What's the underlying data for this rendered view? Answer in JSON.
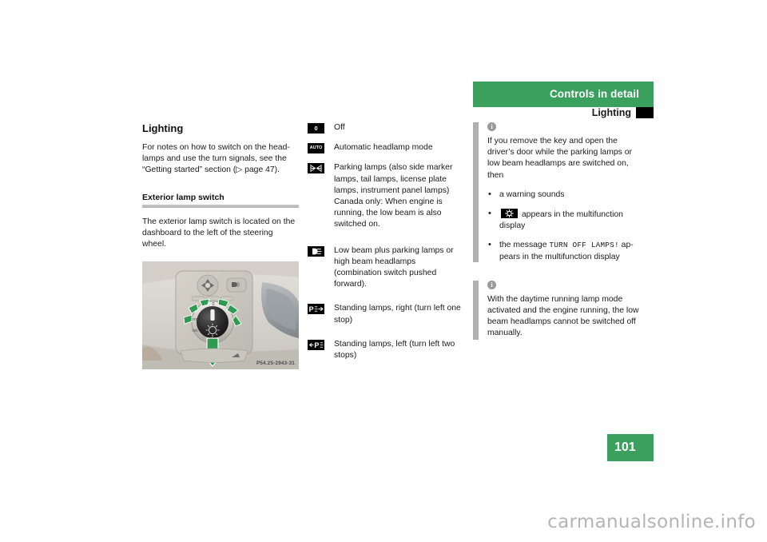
{
  "header": {
    "banner_title": "Controls in detail",
    "sub_title": "Lighting",
    "banner_color": "#3aa05e"
  },
  "left_column": {
    "heading": "Lighting",
    "intro": "For notes on how to switch on the head-lamps and use the turn signals, see the “Getting started” section (▷ page 47).",
    "subheading": "Exterior lamp switch",
    "body": "The exterior lamp switch is located on the dashboard to the left of the steering wheel.",
    "figure_caption": "P54.25-2943-31"
  },
  "switch_positions": [
    {
      "icon": "off-position-icon",
      "icon_label": "0",
      "text": "Off"
    },
    {
      "icon": "auto-headlamp-icon",
      "icon_label": "AUTO",
      "text": "Automatic headlamp mode"
    },
    {
      "icon": "parking-lamps-icon",
      "icon_label": "",
      "text": "Parking lamps (also side marker lamps, tail lamps, license plate lamps, instrument panel lamps) Canada only: When engine is running, the low beam is also switched on."
    },
    {
      "icon": "low-beam-headlamp-icon",
      "icon_label": "",
      "text": "Low beam plus parking lamps or high beam headlamps (combination switch pushed forward)."
    },
    {
      "icon": "standing-lamps-right-icon",
      "icon_label": "P",
      "text": "Standing lamps, right (turn left one stop)"
    },
    {
      "icon": "standing-lamps-left-icon",
      "icon_label": "P",
      "text": "Standing lamps, left (turn left two stops)"
    }
  ],
  "notes": [
    {
      "icon": "info-icon",
      "intro": "If you remove the key and open the driver’s door while the parking lamps or low beam headlamps are switched on, then",
      "bullets": [
        {
          "pre": "a warning sounds",
          "icon": "",
          "mono": "",
          "post": ""
        },
        {
          "pre": "",
          "icon": "lamp-warning-icon",
          "mono": "",
          "post": "appears in the multifunction display"
        },
        {
          "pre": "the message",
          "icon": "",
          "mono": "TURN OFF LAMPS!",
          "post": "ap-pears in the multifunction display"
        }
      ]
    },
    {
      "icon": "info-icon",
      "intro": "With the daytime running lamp mode activated and the engine running, the low beam headlamps cannot be switched off manually.",
      "bullets": []
    }
  ],
  "page": {
    "number": "101",
    "watermark": "carmanualsonline.info"
  }
}
